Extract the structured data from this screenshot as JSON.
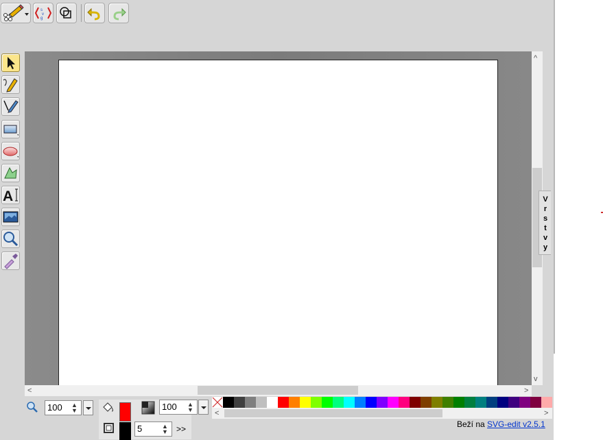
{
  "toolbar": {
    "main_menu": "main-menu-button",
    "svg_source": "source-editor-button",
    "wireframe": "wireframe-button",
    "undo": "undo-button",
    "redo": "redo-button"
  },
  "tools": [
    {
      "name": "select-tool",
      "icon": "arrow-cursor-icon",
      "active": true
    },
    {
      "name": "pencil-tool",
      "icon": "pencil-icon",
      "active": false
    },
    {
      "name": "line-tool",
      "icon": "pen-line-icon",
      "active": false
    },
    {
      "name": "rectangle-tool",
      "icon": "rectangle-icon",
      "active": false
    },
    {
      "name": "ellipse-tool",
      "icon": "ellipse-icon",
      "active": false
    },
    {
      "name": "path-tool",
      "icon": "polygon-icon",
      "active": false
    },
    {
      "name": "text-tool",
      "icon": "text-icon",
      "active": false
    },
    {
      "name": "image-tool",
      "icon": "image-icon",
      "active": false
    },
    {
      "name": "zoom-tool",
      "icon": "magnifier-icon",
      "active": false
    },
    {
      "name": "eyedropper-tool",
      "icon": "eyedropper-icon",
      "active": false
    }
  ],
  "layers_tab": {
    "label": "Vrstvy",
    "letters": [
      "V",
      "r",
      "s",
      "t",
      "v",
      "y"
    ]
  },
  "bottom": {
    "zoom_value": "100",
    "opacity_value": "100",
    "stroke_width": "5",
    "more_button": ">>",
    "fill_color": "#ff0000",
    "stroke_color": "#000000"
  },
  "palette": [
    "#000000",
    "#3f3f3f",
    "#7f7f7f",
    "#bfbfbf",
    "#ffffff",
    "#ff0000",
    "#ff7f00",
    "#ffff00",
    "#7fff00",
    "#00ff00",
    "#00ff7f",
    "#00ffff",
    "#007fff",
    "#0000ff",
    "#7f00ff",
    "#ff00ff",
    "#ff007f",
    "#7f0000",
    "#7f3f00",
    "#7f7f00",
    "#3f7f00",
    "#007f00",
    "#007f3f",
    "#007f7f",
    "#003f7f",
    "#00007f",
    "#3f007f",
    "#7f007f",
    "#7f003f",
    "#ffaaaa"
  ],
  "credit": {
    "prefix": "Beží na",
    "link": "SVG-edit v2.5.1"
  }
}
